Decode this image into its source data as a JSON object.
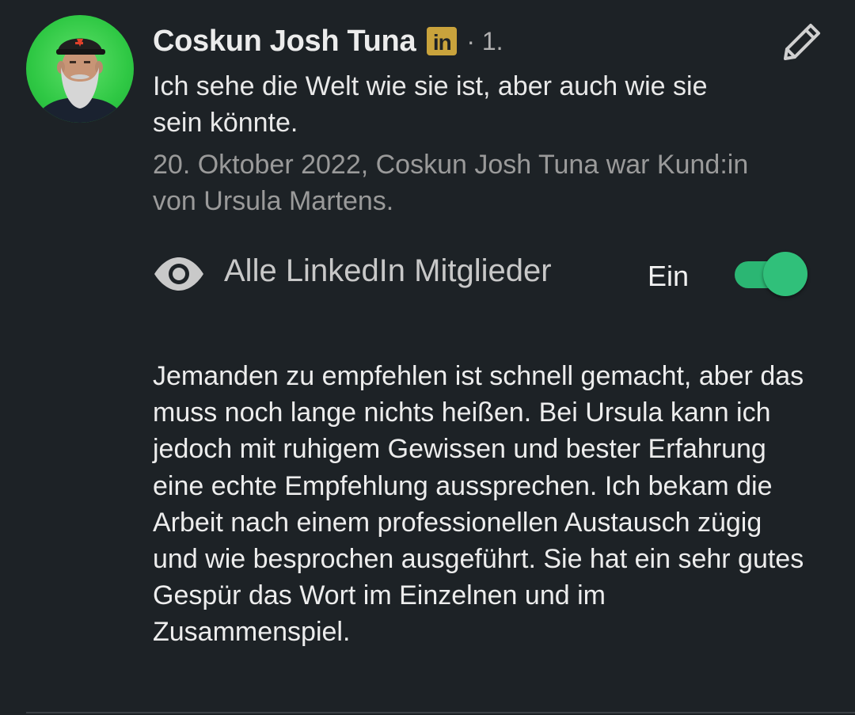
{
  "recommendation": {
    "author_name": "Coskun Josh Tuna",
    "badge_text": "in",
    "connection_degree": "· 1.",
    "headline": "Ich sehe die Welt wie sie ist, aber auch wie sie sein könnte.",
    "meta": "20. Oktober 2022, Coskun Josh Tuna war Kund:in von Ursula Martens.",
    "visibility": {
      "label": "Alle LinkedIn Mitglieder",
      "toggle_state": "Ein",
      "enabled": true
    },
    "body": "Jemanden zu empfehlen ist schnell gemacht, aber das muss noch lange nichts heißen. Bei Ursula kann ich jedoch mit ruhigem Gewissen und bester Erfahrung eine echte Empfehlung aussprechen. Ich bekam die Arbeit nach einem professionellen Austausch zügig und wie besprochen ausgeführt. Sie hat ein sehr gutes Gespür das Wort im Einzelnen und im Zusammenspiel."
  },
  "icons": {
    "edit": "pencil-icon",
    "visibility": "eye-icon",
    "badge": "linkedin-premium-icon"
  },
  "colors": {
    "background": "#1d2226",
    "badge": "#c9a33c",
    "toggle_on": "#2bb673",
    "avatar_bg": "#2fc844"
  }
}
